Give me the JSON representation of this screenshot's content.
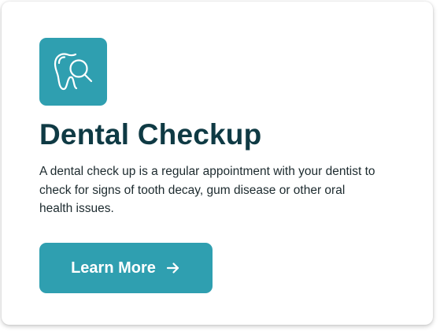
{
  "card": {
    "icon": "tooth-magnifier-icon",
    "title": "Dental Checkup",
    "description": "A dental check up is a regular appointment with your dentist to check for signs of tooth decay, gum disease or other oral health issues.",
    "cta": {
      "label": "Learn More",
      "icon": "arrow-right-icon"
    }
  },
  "colors": {
    "accent": "#2f9fb0",
    "title": "#0f3a44",
    "text": "#1c2a2e",
    "card_background": "#ffffff"
  }
}
